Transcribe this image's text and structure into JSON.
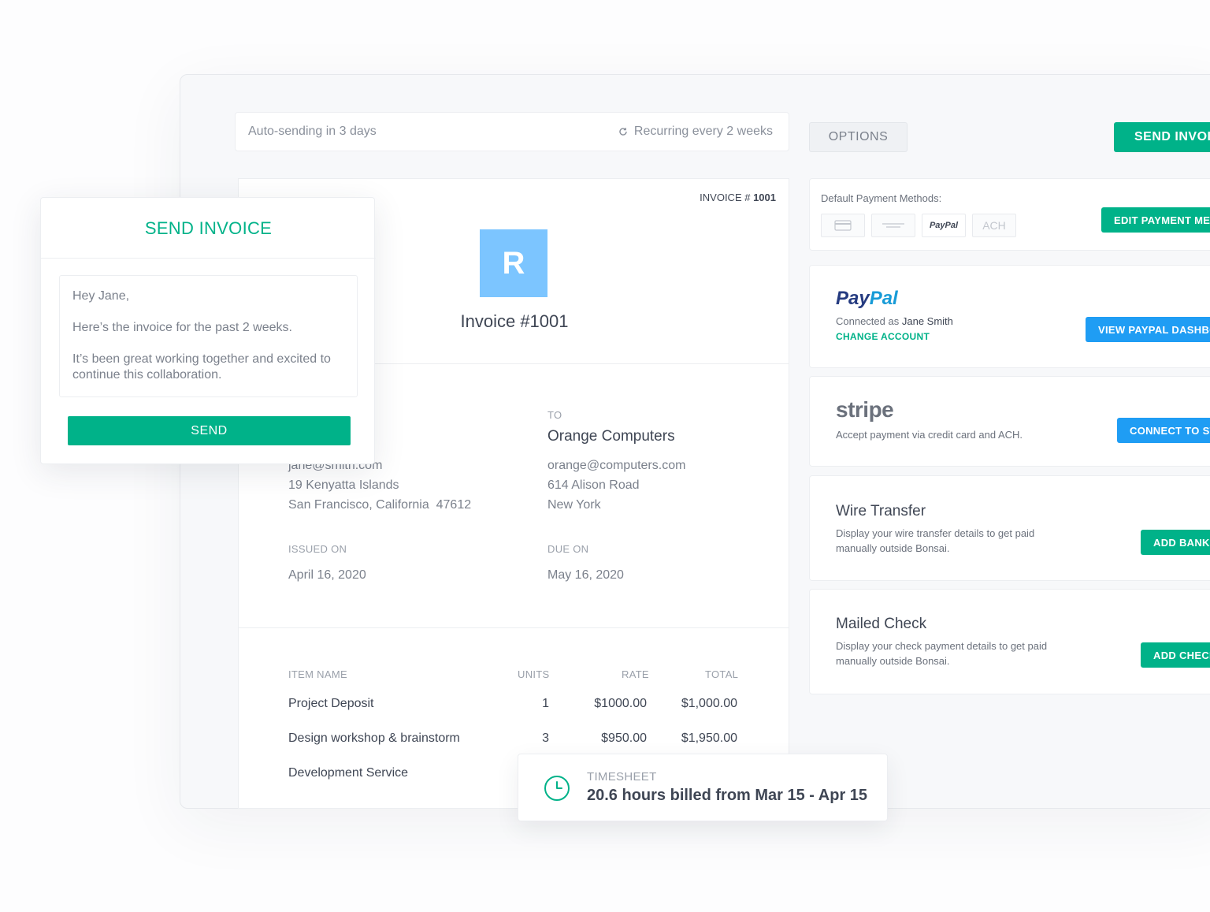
{
  "topbar": {
    "autosend_text": "Auto-sending in 3 days",
    "recurring_text": "Recurring every 2 weeks",
    "options_label": "OPTIONS",
    "send_invoice_label": "SEND INVOICE"
  },
  "invoice": {
    "number_prefix": "INVOICE #",
    "number": "1001",
    "logo_letter": "R",
    "title": "Invoice #1001",
    "from": {
      "email": "jane@smith.com",
      "address1": "19 Kenyatta Islands",
      "address2": "San Francisco, California  47612"
    },
    "to": {
      "label": "TO",
      "name": "Orange Computers",
      "email": "orange@computers.com",
      "address1": "614 Alison Road",
      "address2": "New York"
    },
    "issued_label": "ISSUED ON",
    "issued_date": "April 16, 2020",
    "due_label": "DUE ON",
    "due_date": "May 16, 2020",
    "columns": [
      "ITEM NAME",
      "UNITS",
      "RATE",
      "TOTAL"
    ],
    "items": [
      {
        "name": "Project Deposit",
        "units": "1",
        "rate": "$1000.00",
        "total": "$1,000.00"
      },
      {
        "name": "Design workshop & brainstorm",
        "units": "3",
        "rate": "$950.00",
        "total": "$1,950.00"
      },
      {
        "name": "Development Service",
        "units": "",
        "rate": "",
        "total": ""
      }
    ]
  },
  "payment_methods": {
    "label": "Default Payment Methods:",
    "badges": [
      "",
      "",
      "PayPal",
      "ACH"
    ],
    "edit_label": "EDIT PAYMENT METHODS"
  },
  "paypal": {
    "logo_pay": "Pay",
    "logo_pal": "Pal",
    "connected_prefix": "Connected as",
    "connected_name": "Jane Smith",
    "change_label": "CHANGE ACCOUNT",
    "dashboard_label": "VIEW PAYPAL DASHBOARD"
  },
  "stripe": {
    "logo": "stripe",
    "text": "Accept payment via credit card and ACH.",
    "connect_label": "CONNECT TO STRIPE"
  },
  "wire": {
    "title": "Wire Transfer",
    "text": "Display your wire transfer details to get paid manually outside Bonsai.",
    "button_label": "ADD BANK"
  },
  "check": {
    "title": "Mailed Check",
    "text": "Display your check payment details to get paid manually outside Bonsai.",
    "button_label": "ADD CHECK"
  },
  "send_popup": {
    "title": "SEND INVOICE",
    "greeting": "Hey Jane,",
    "line1": "Here’s the invoice for the past 2 weeks.",
    "line2": "It’s been great working together and excited to continue this collaboration.",
    "send_label": "SEND"
  },
  "timesheet": {
    "label": "TIMESHEET",
    "text": "20.6 hours billed from Mar 15 - Apr 15"
  },
  "colors": {
    "accent_green": "#00b289",
    "accent_blue": "#1f9df4",
    "logo_blue": "#7cc5ff",
    "paypal_dark": "#253b80",
    "paypal_light": "#179bd7"
  }
}
